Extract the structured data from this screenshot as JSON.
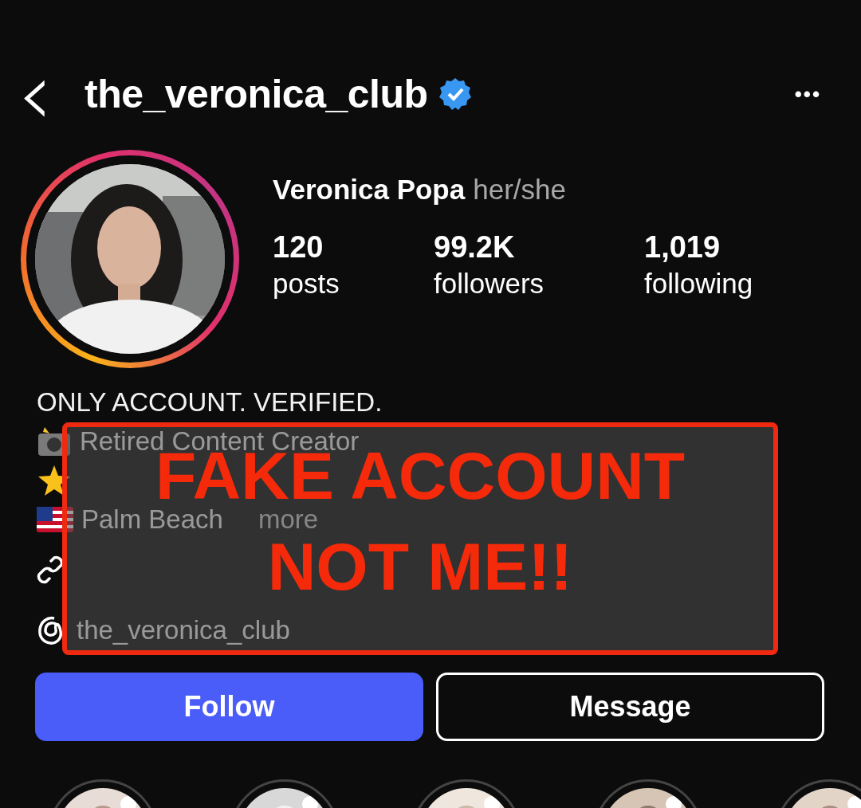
{
  "header": {
    "back": "‹",
    "username": "the_veronica_club",
    "verified": true,
    "more": "•••"
  },
  "profile": {
    "name": "Veronica Popa",
    "pronouns": "her/she",
    "has_story": true,
    "stats": [
      {
        "value": "120",
        "label": "posts"
      },
      {
        "value": "99.2K",
        "label": "followers"
      },
      {
        "value": "1,019",
        "label": "following"
      }
    ]
  },
  "bio": [
    {
      "kind": "plain",
      "text": "ONLY ACCOUNT. VERIFIED."
    },
    {
      "kind": "camera",
      "text": "Retired Content Creator"
    },
    {
      "kind": "star"
    },
    {
      "kind": "flag",
      "text": "Palm Beach",
      "more": "more"
    }
  ],
  "link": {
    "kind": "link"
  },
  "threads": {
    "text": "the_veronica_club"
  },
  "buttons": [
    {
      "kind": "primary",
      "label": "Follow"
    },
    {
      "kind": "outline",
      "label": "Message"
    }
  ],
  "overlay": {
    "lines": [
      "FAKE ACCOUNT",
      "NOT ME!!"
    ]
  }
}
